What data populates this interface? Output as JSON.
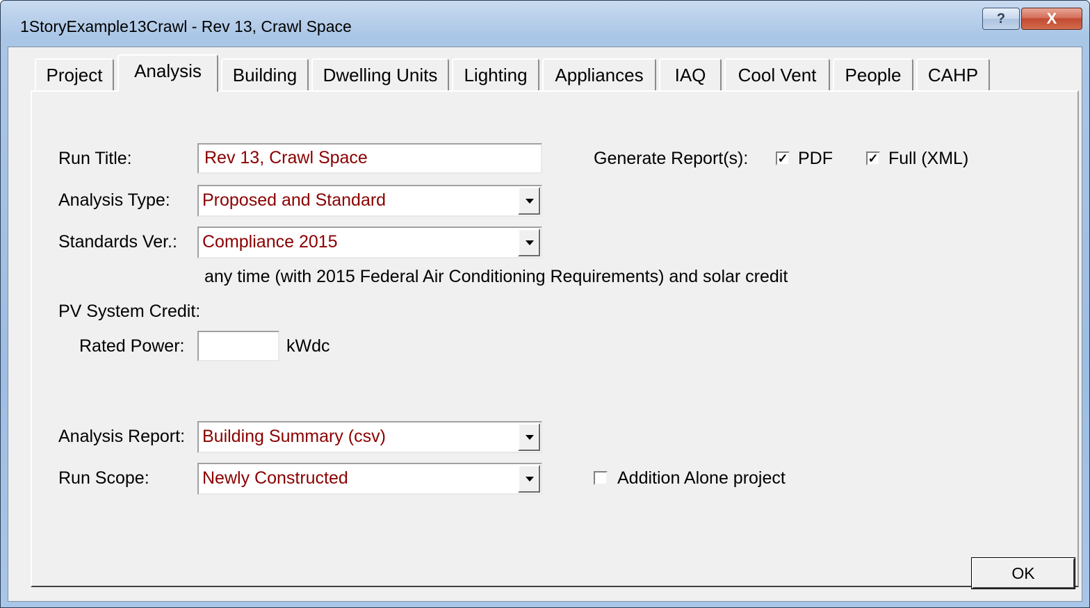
{
  "window": {
    "title": "1StoryExample13Crawl - Rev 13, Crawl Space",
    "help_glyph": "?",
    "close_glyph": "X"
  },
  "tabs": [
    {
      "label": "Project",
      "active": false
    },
    {
      "label": "Analysis",
      "active": true
    },
    {
      "label": "Building",
      "active": false
    },
    {
      "label": "Dwelling Units",
      "active": false
    },
    {
      "label": "Lighting",
      "active": false
    },
    {
      "label": "Appliances",
      "active": false
    },
    {
      "label": "IAQ",
      "active": false
    },
    {
      "label": "Cool Vent",
      "active": false
    },
    {
      "label": "People",
      "active": false
    },
    {
      "label": "CAHP",
      "active": false
    }
  ],
  "analysis": {
    "run_title_label": "Run Title:",
    "run_title_value": "Rev 13, Crawl Space",
    "generate_reports_label": "Generate Report(s):",
    "pdf_label": "PDF",
    "pdf_checked": true,
    "full_xml_label": "Full (XML)",
    "full_xml_checked": true,
    "analysis_type_label": "Analysis Type:",
    "analysis_type_value": "Proposed and Standard",
    "standards_ver_label": "Standards Ver.:",
    "standards_ver_value": "Compliance 2015",
    "standards_note": "any time (with 2015 Federal Air Conditioning Requirements) and solar credit",
    "pv_credit_label": "PV System Credit:",
    "rated_power_label": "Rated Power:",
    "rated_power_value": "",
    "rated_power_unit": "kWdc",
    "analysis_report_label": "Analysis Report:",
    "analysis_report_value": "Building Summary (csv)",
    "run_scope_label": "Run Scope:",
    "run_scope_value": "Newly Constructed",
    "addition_alone_label": "Addition Alone project",
    "addition_alone_checked": false
  },
  "footer": {
    "ok_label": "OK"
  },
  "colors": {
    "field_text": "#8b0000",
    "dialog_bg": "#f0f0f0",
    "titlebar": "#9dbde2",
    "close_button": "#c24a31"
  }
}
